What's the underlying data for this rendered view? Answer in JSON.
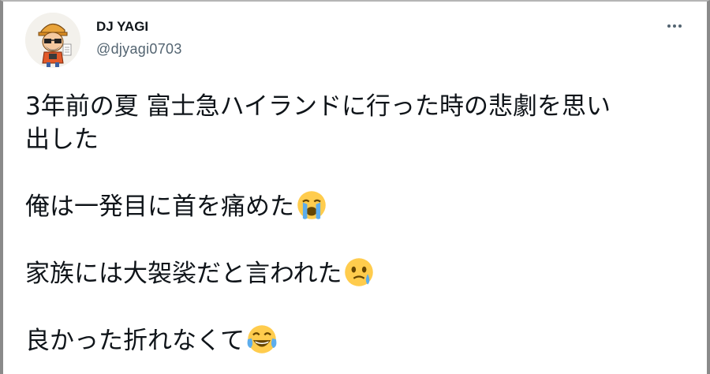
{
  "tweet": {
    "display_name": "DJ YAGI",
    "handle": "@djyagi0703",
    "more_icon": "more-horizontal-icon",
    "lines": [
      "3年前の夏 富士急ハイランドに行った時の悲劇を思い",
      "出した",
      "俺は一発目に首を痛めた",
      "家族には大袈裟だと言われた",
      "良かった折れなくて"
    ],
    "emojis": [
      "loudly-crying-face",
      "face-holding-back-tears",
      "face-with-tears-of-joy"
    ]
  },
  "colors": {
    "text": "#0f1419",
    "secondary": "#536471",
    "emoji_yellow": "#ffcc4d",
    "tear_blue": "#5dadec",
    "frame": "#8a8a8a"
  }
}
